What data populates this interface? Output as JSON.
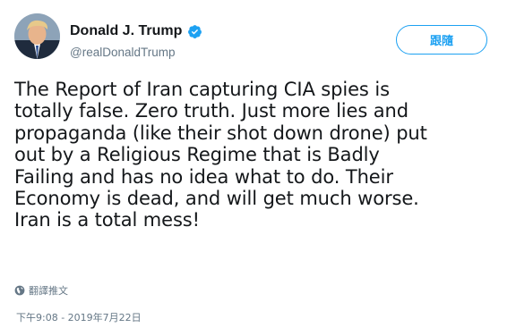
{
  "user": {
    "display_name": "Donald J. Trump",
    "handle": "@realDonaldTrump",
    "verified": true,
    "avatar_icon": "profile-photo"
  },
  "follow_button": {
    "label": "跟隨"
  },
  "tweet": {
    "lines": [
      "The Report of Iran capturing CIA spies is",
      "totally false. Zero truth. Just more lies and",
      "propaganda (like their shot down drone) put",
      "out by a Religious Regime that is Badly",
      "Failing and has no idea what to do. Their",
      "Economy is dead, and will get much worse.",
      "Iran is a total mess!"
    ]
  },
  "translate": {
    "label": "翻譯推文",
    "icon": "globe-icon"
  },
  "timestamp": "下午9:08 - 2019年7月22日",
  "colors": {
    "accent": "#1da1f2",
    "text": "#14171a",
    "muted": "#657786"
  }
}
